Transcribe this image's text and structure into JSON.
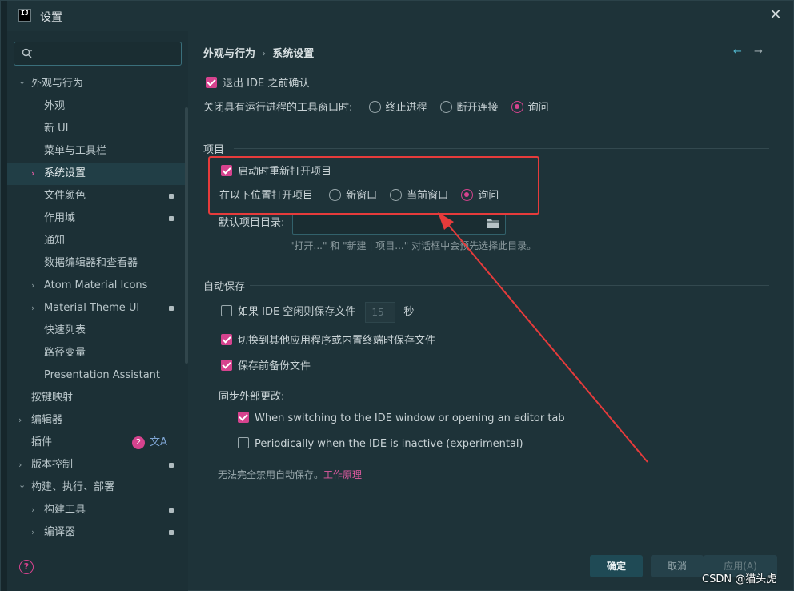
{
  "window": {
    "title": "设置",
    "app_icon_text": "IJ"
  },
  "sidebar": {
    "search_placeholder": "",
    "items": [
      {
        "label": "外观与行为",
        "level": 0,
        "chevron": "down"
      },
      {
        "label": "外观",
        "level": 1
      },
      {
        "label": "新 UI",
        "level": 1
      },
      {
        "label": "菜单与工具栏",
        "level": 1
      },
      {
        "label": "系统设置",
        "level": 1,
        "chevron": "right",
        "selected": true
      },
      {
        "label": "文件颜色",
        "level": 1,
        "pin": true
      },
      {
        "label": "作用域",
        "level": 1,
        "pin": true
      },
      {
        "label": "通知",
        "level": 1
      },
      {
        "label": "数据编辑器和查看器",
        "level": 1
      },
      {
        "label": "Atom Material Icons",
        "level": 1,
        "chevron": "right"
      },
      {
        "label": "Material Theme UI",
        "level": 1,
        "chevron": "right",
        "pin": true
      },
      {
        "label": "快速列表",
        "level": 1
      },
      {
        "label": "路径变量",
        "level": 1
      },
      {
        "label": "Presentation Assistant",
        "level": 1
      },
      {
        "label": "按键映射",
        "level": 0
      },
      {
        "label": "编辑器",
        "level": 0,
        "chevron": "right"
      },
      {
        "label": "插件",
        "level": 0,
        "badge": "2",
        "translate_icon": "文A"
      },
      {
        "label": "版本控制",
        "level": 0,
        "chevron": "right",
        "pin": true
      },
      {
        "label": "构建、执行、部署",
        "level": 0,
        "chevron": "down"
      },
      {
        "label": "构建工具",
        "level": 1,
        "chevron": "right",
        "pin": true
      },
      {
        "label": "编译器",
        "level": 1,
        "chevron": "right",
        "pin": true
      }
    ],
    "help_icon": "?"
  },
  "main": {
    "breadcrumb": {
      "parent": "外观与行为",
      "sep": "›",
      "current": "系统设置"
    },
    "nav": {
      "back": "←",
      "forward": "→"
    },
    "confirm_exit": "退出 IDE 之前确认",
    "close_tool_label": "关闭具有运行进程的工具窗口时:",
    "close_tool_options": [
      "终止进程",
      "断开连接",
      "询问"
    ],
    "close_tool_selected": 2,
    "project_section": "项目",
    "reopen_projects": "启动时重新打开项目",
    "open_in_label": "在以下位置打开项目",
    "open_in_options": [
      "新窗口",
      "当前窗口",
      "询问"
    ],
    "open_in_selected": 2,
    "default_dir_label": "默认项目目录:",
    "default_dir_value": "",
    "default_dir_hint": "\"打开...\" 和 \"新建 | 项目...\" 对话框中会预先选择此目录。",
    "autosave_section": "自动保存",
    "idle_save_label": "如果 IDE 空闲则保存文件",
    "idle_save_value": "15",
    "idle_save_unit": "秒",
    "switch_save": "切换到其他应用程序或内置终端时保存文件",
    "backup_save": "保存前备份文件",
    "sync_label": "同步外部更改:",
    "sync_switching": "When switching to the IDE window or opening an editor tab",
    "sync_periodic": "Periodically when the IDE is inactive (experimental)",
    "autosave_note": "无法完全禁用自动保存。",
    "autosave_link": "工作原理"
  },
  "footer": {
    "ok": "确定",
    "cancel": "取消",
    "apply": "应用(A)"
  },
  "watermark": "CSDN @猫头虎",
  "colors": {
    "accent": "#d6438e",
    "annotation": "#e63b3b",
    "background": "#1e3339"
  }
}
